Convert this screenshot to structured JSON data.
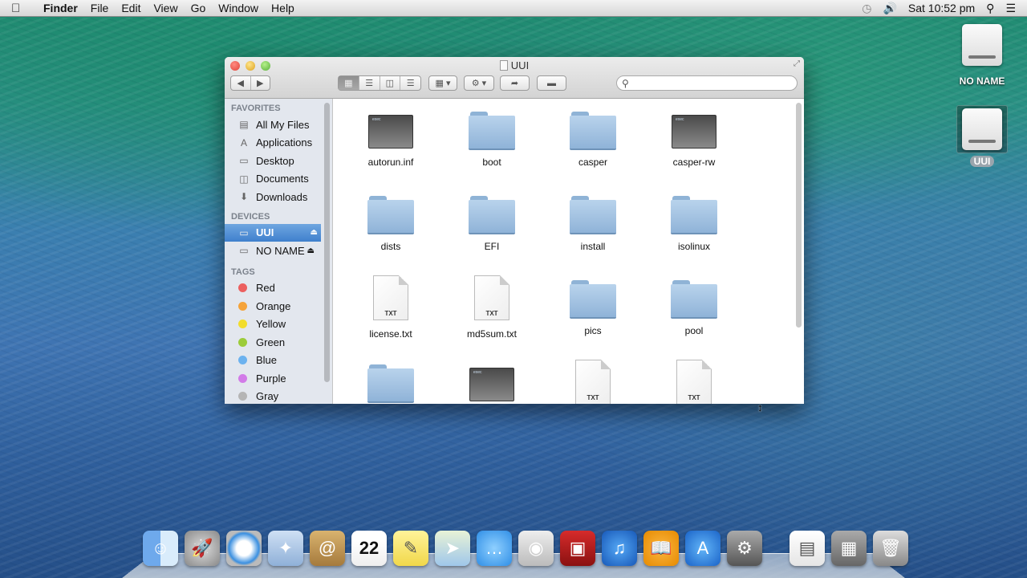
{
  "menubar": {
    "apple": "",
    "app": "Finder",
    "items": [
      "File",
      "Edit",
      "View",
      "Go",
      "Window",
      "Help"
    ],
    "clock": "Sat 10:52 pm",
    "icons": [
      "time-machine-icon",
      "volume-icon",
      "spotlight-icon",
      "notification-center-icon"
    ]
  },
  "desktop": {
    "drives": [
      {
        "label": "NO NAME",
        "selected": false
      },
      {
        "label": "UUI",
        "selected": true
      }
    ]
  },
  "window": {
    "title": "UUI",
    "toolbar": {
      "nav": [
        "◀",
        "▶"
      ],
      "views": [
        "icon-view",
        "list-view",
        "column-view",
        "cover-flow-view"
      ],
      "active_view": "icon-view",
      "search_placeholder": ""
    },
    "sidebar": {
      "favorites_header": "FAVORITES",
      "favorites": [
        "All My Files",
        "Applications",
        "Desktop",
        "Documents",
        "Downloads"
      ],
      "devices_header": "DEVICES",
      "devices": [
        {
          "label": "UUI",
          "selected": true
        },
        {
          "label": "NO NAME",
          "selected": false
        }
      ],
      "tags_header": "TAGS",
      "tags": [
        {
          "label": "Red",
          "color": "#ec5f5f"
        },
        {
          "label": "Orange",
          "color": "#f5a33a"
        },
        {
          "label": "Yellow",
          "color": "#f2dd2c"
        },
        {
          "label": "Green",
          "color": "#9ccc3a"
        },
        {
          "label": "Blue",
          "color": "#6cb2ef"
        },
        {
          "label": "Purple",
          "color": "#d27be8"
        },
        {
          "label": "Gray",
          "color": "#b5b5b5"
        }
      ]
    },
    "files": [
      {
        "name": "autorun.inf",
        "type": "exec"
      },
      {
        "name": "boot",
        "type": "folder"
      },
      {
        "name": "casper",
        "type": "folder"
      },
      {
        "name": "casper-rw",
        "type": "exec"
      },
      {
        "name": "dists",
        "type": "folder"
      },
      {
        "name": "EFI",
        "type": "folder"
      },
      {
        "name": "install",
        "type": "folder"
      },
      {
        "name": "isolinux",
        "type": "folder"
      },
      {
        "name": "license.txt",
        "type": "txt"
      },
      {
        "name": "md5sum.txt",
        "type": "txt"
      },
      {
        "name": "pics",
        "type": "folder"
      },
      {
        "name": "pool",
        "type": "folder"
      },
      {
        "name": "",
        "type": "folder"
      },
      {
        "name": "",
        "type": "exec"
      },
      {
        "name": "",
        "type": "txt"
      },
      {
        "name": "",
        "type": "txt"
      }
    ],
    "txt_badge": "TXT"
  },
  "dock": {
    "calendar_day": "22",
    "items": [
      "Finder",
      "Launchpad",
      "Safari",
      "Mail",
      "Contacts",
      "Calendar",
      "Notes",
      "Maps",
      "Messages",
      "FaceTime",
      "Photo Booth",
      "iTunes",
      "iBooks",
      "App Store",
      "System Preferences",
      "Document",
      "Downloads Stack",
      "Trash"
    ]
  }
}
